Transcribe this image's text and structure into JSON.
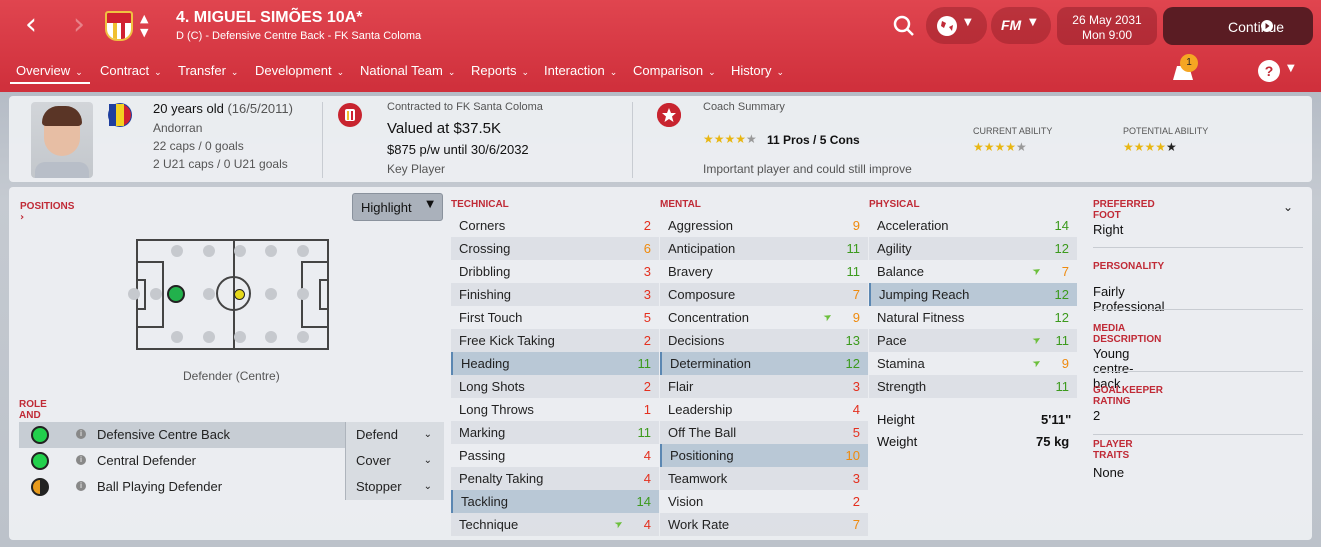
{
  "header": {
    "title": "4. MIGUEL SIMÕES 10A*",
    "subtitle": "D (C) - Defensive Centre Back - FK Santa Coloma",
    "date": "26 May 2031",
    "time": "Mon 9:00",
    "continue_label": "Continue",
    "fm_label": "FM"
  },
  "tabs": [
    {
      "label": "Overview"
    },
    {
      "label": "Contract"
    },
    {
      "label": "Transfer"
    },
    {
      "label": "Development"
    },
    {
      "label": "National Team"
    },
    {
      "label": "Reports"
    },
    {
      "label": "Interaction"
    },
    {
      "label": "Comparison"
    },
    {
      "label": "History"
    }
  ],
  "notification_count": "1",
  "profile": {
    "age": "20 years old",
    "dob": "(16/5/2011)",
    "nationality": "Andorran",
    "caps": "22 caps / 0 goals",
    "u21caps": "2 U21 caps / 0 U21 goals"
  },
  "contract": {
    "contracted": "Contracted to FK Santa Coloma",
    "value": "Valued at $37.5K",
    "wage": "$875 p/w until 30/6/2032",
    "status": "Key Player"
  },
  "coach": {
    "heading": "Coach Summary",
    "pros_cons": "11 Pros / 5 Cons",
    "summary": "Important player and could still improve",
    "ca_label": "CURRENT ABILITY",
    "pa_label": "POTENTIAL ABILITY",
    "coach_stars": 4,
    "current_ability_stars": 4,
    "potential_ability_stars": 4.5
  },
  "positions": {
    "heading": "POSITIONS",
    "position_label": "Defender (Centre)",
    "highlight_label": "Highlight"
  },
  "roles": {
    "heading": "ROLE AND DUTY",
    "items": [
      {
        "name": "Defensive Centre Back",
        "duty": "Defend"
      },
      {
        "name": "Central Defender",
        "duty": "Cover"
      },
      {
        "name": "Ball Playing Defender",
        "duty": "Stopper"
      }
    ]
  },
  "technical": {
    "heading": "TECHNICAL",
    "attrs": [
      {
        "name": "Corners",
        "value": "2"
      },
      {
        "name": "Crossing",
        "value": "6"
      },
      {
        "name": "Dribbling",
        "value": "3"
      },
      {
        "name": "Finishing",
        "value": "3"
      },
      {
        "name": "First Touch",
        "value": "5"
      },
      {
        "name": "Free Kick Taking",
        "value": "2"
      },
      {
        "name": "Heading",
        "value": "11"
      },
      {
        "name": "Long Shots",
        "value": "2"
      },
      {
        "name": "Long Throws",
        "value": "1"
      },
      {
        "name": "Marking",
        "value": "11"
      },
      {
        "name": "Passing",
        "value": "4"
      },
      {
        "name": "Penalty Taking",
        "value": "4"
      },
      {
        "name": "Tackling",
        "value": "14"
      },
      {
        "name": "Technique",
        "value": "4"
      }
    ]
  },
  "mental": {
    "heading": "MENTAL",
    "attrs": [
      {
        "name": "Aggression",
        "value": "9"
      },
      {
        "name": "Anticipation",
        "value": "11"
      },
      {
        "name": "Bravery",
        "value": "11"
      },
      {
        "name": "Composure",
        "value": "7"
      },
      {
        "name": "Concentration",
        "value": "9"
      },
      {
        "name": "Decisions",
        "value": "13"
      },
      {
        "name": "Determination",
        "value": "12"
      },
      {
        "name": "Flair",
        "value": "3"
      },
      {
        "name": "Leadership",
        "value": "4"
      },
      {
        "name": "Off The Ball",
        "value": "5"
      },
      {
        "name": "Positioning",
        "value": "10"
      },
      {
        "name": "Teamwork",
        "value": "3"
      },
      {
        "name": "Vision",
        "value": "2"
      },
      {
        "name": "Work Rate",
        "value": "7"
      }
    ]
  },
  "physical": {
    "heading": "PHYSICAL",
    "attrs": [
      {
        "name": "Acceleration",
        "value": "14"
      },
      {
        "name": "Agility",
        "value": "12"
      },
      {
        "name": "Balance",
        "value": "7"
      },
      {
        "name": "Jumping Reach",
        "value": "12"
      },
      {
        "name": "Natural Fitness",
        "value": "12"
      },
      {
        "name": "Pace",
        "value": "11"
      },
      {
        "name": "Stamina",
        "value": "9"
      },
      {
        "name": "Strength",
        "value": "11"
      }
    ],
    "height_label": "Height",
    "height": "5'11\"",
    "weight_label": "Weight",
    "weight": "75 kg"
  },
  "side": {
    "preferred_foot_label": "PREFERRED FOOT",
    "preferred_foot": "Right",
    "personality_label": "PERSONALITY",
    "personality": "Fairly Professional",
    "media_label": "MEDIA DESCRIPTION",
    "media": "Young centre-back",
    "gk_label": "GOALKEEPER RATING",
    "gk": "2",
    "traits_label": "PLAYER TRAITS",
    "traits": "None"
  },
  "colors": {
    "accent": "#c02a36",
    "header_red": "#d63a45",
    "attr_low": "#e4301f",
    "attr_mid": "#ef8a0d",
    "attr_high": "#3c9a1d",
    "position_natural": "#22b14c"
  }
}
